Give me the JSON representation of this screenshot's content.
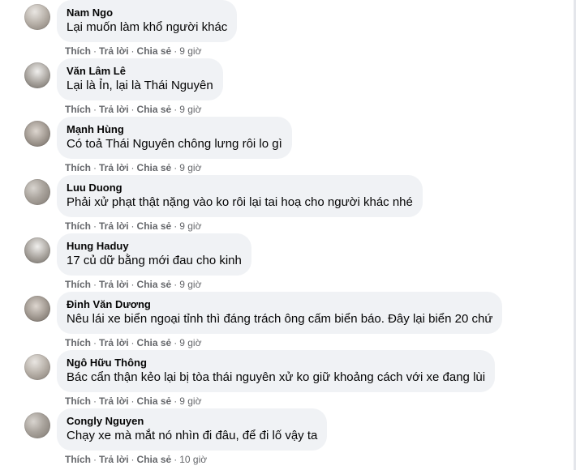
{
  "comments": [
    {
      "author": "Nam Ngo",
      "text": "Lại muốn làm khổ người khác",
      "actions": {
        "like": "Thích",
        "reply": "Trả lời",
        "share": "Chia sẻ"
      },
      "time": "9 giờ"
    },
    {
      "author": "Văn Lâm Lê",
      "text": "Lại là Ỉn, lại là Thái Nguyên",
      "actions": {
        "like": "Thích",
        "reply": "Trả lời",
        "share": "Chia sẻ"
      },
      "time": "9 giờ"
    },
    {
      "author": "Mạnh Hùng",
      "text": "Có toả Thái Nguyên chông lưng rôi lo gì",
      "actions": {
        "like": "Thích",
        "reply": "Trả lời",
        "share": "Chia sẻ"
      },
      "time": "9 giờ"
    },
    {
      "author": "Luu Duong",
      "text": "Phải xử phạt thật nặng vào ko rôi lại tai hoạ cho người khác nhé",
      "actions": {
        "like": "Thích",
        "reply": "Trả lời",
        "share": "Chia sẻ"
      },
      "time": "9 giờ"
    },
    {
      "author": "Hung Haduy",
      "text": "17 củ dữ bằng mới đau cho kinh",
      "actions": {
        "like": "Thích",
        "reply": "Trả lời",
        "share": "Chia sẻ"
      },
      "time": "9 giờ"
    },
    {
      "author": "Đinh Văn Dương",
      "text": "Nêu lái xe biển ngoại tỉnh thì đáng trách ông cấm biển báo. Đây lại biển 20 chứ",
      "actions": {
        "like": "Thích",
        "reply": "Trả lời",
        "share": "Chia sẻ"
      },
      "time": "9 giờ"
    },
    {
      "author": "Ngô Hữu Thông",
      "text": "Bác cẩn thận kẻo lại bị tòa thái nguyên xử ko giữ khoảng cách với xe đang lùi",
      "actions": {
        "like": "Thích",
        "reply": "Trả lời",
        "share": "Chia sẻ"
      },
      "time": "9 giờ"
    },
    {
      "author": "Congly Nguyen",
      "text": "Chạy xe mà mắt nó nhìn đi đâu, để đi lố vậy ta",
      "actions": {
        "like": "Thích",
        "reply": "Trả lời",
        "share": "Chia sẻ"
      },
      "time": "10 giờ"
    }
  ]
}
